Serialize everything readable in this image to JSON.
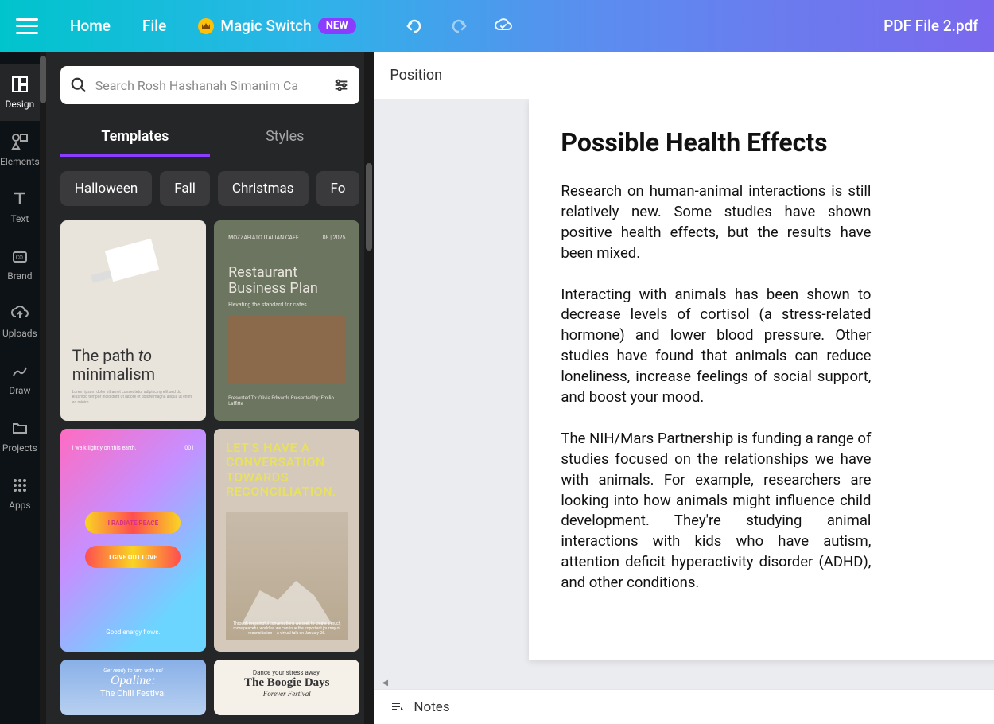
{
  "topbar": {
    "home": "Home",
    "file": "File",
    "magicSwitch": "Magic Switch",
    "newBadge": "NEW",
    "filename": "PDF File 2.pdf"
  },
  "leftNav": {
    "design": "Design",
    "elements": "Elements",
    "text": "Text",
    "brand": "Brand",
    "uploads": "Uploads",
    "draw": "Draw",
    "projects": "Projects",
    "apps": "Apps"
  },
  "panel": {
    "searchPlaceholder": "Search Rosh Hashanah Simanim Ca",
    "tabs": {
      "templates": "Templates",
      "styles": "Styles"
    },
    "chips": [
      "Halloween",
      "Fall",
      "Christmas",
      "Fo"
    ],
    "templates": {
      "t1": {
        "title1": "The path ",
        "title2": "to",
        "title3": "minimalism"
      },
      "t2": {
        "brand": "MOZZAFIATO ITALIAN CAFE",
        "date": "08 | 2025",
        "title": "Restaurant Business Plan",
        "sub": "Elevating the standard for cafes",
        "foot": "Presented To: Olivia Edwards    Presented by: Emilio Laffitte"
      },
      "t3": {
        "tl": "I walk lightly on this earth.",
        "tr": "001",
        "p1": "I RADIATE PEACE",
        "p2": "I GIVE OUT LOVE",
        "bot": "Good energy flows."
      },
      "t4": {
        "title": "LET'S HAVE A CONVERSATION TOWARDS RECONCILIATION.",
        "foot": "Through meaningful conversations we seek to create a much more peaceful world as we continue the important journey of reconciliation – a virtual talk on January 26."
      },
      "t5": {
        "a": "Get ready to jam with us!",
        "b": "Opaline:",
        "c": "The Chill Festival"
      },
      "t6": {
        "a": "Dance your stress away.",
        "b": "The Boogie Days",
        "c": "Forever Festival"
      }
    }
  },
  "canvas": {
    "position": "Position",
    "notes": "Notes",
    "document": {
      "title": "Possible Health Effects",
      "p1": "Research on human-animal interactions is still relatively new. Some studies have shown positive health effects, but the results have been mixed.",
      "p2": "Interacting with animals has been shown to decrease levels of cortisol (a stress-related hormone) and lower blood pressure. Other studies have found that animals can reduce loneliness, increase feelings of social support, and boost your mood.",
      "p3": "The NIH/Mars Partnership is funding a range of studies focused on the relationships we have with animals. For example, researchers are looking into how animals might influence child development. They're studying animal interactions with kids who have autism, attention deficit hyperactivity disorder (ADHD), and other conditions."
    }
  }
}
